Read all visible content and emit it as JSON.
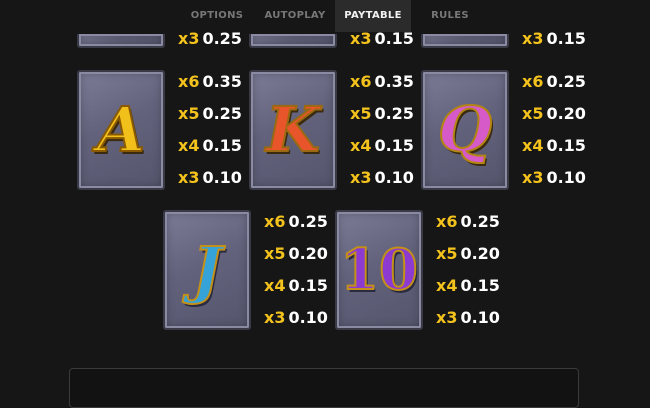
{
  "tabs": [
    {
      "label": "OPTIONS",
      "active": false
    },
    {
      "label": "AUTOPLAY",
      "active": false
    },
    {
      "label": "PAYTABLE",
      "active": true
    },
    {
      "label": "RULES",
      "active": false
    }
  ],
  "top_partial_rows": [
    {
      "mult": "x3",
      "amount": "0.25"
    },
    {
      "mult": "x3",
      "amount": "0.15"
    },
    {
      "mult": "x3",
      "amount": "0.15"
    }
  ],
  "symbols": [
    {
      "glyph": "A",
      "pays": [
        {
          "mult": "x6",
          "amount": "0.35"
        },
        {
          "mult": "x5",
          "amount": "0.25"
        },
        {
          "mult": "x4",
          "amount": "0.15"
        },
        {
          "mult": "x3",
          "amount": "0.10"
        }
      ]
    },
    {
      "glyph": "K",
      "pays": [
        {
          "mult": "x6",
          "amount": "0.35"
        },
        {
          "mult": "x5",
          "amount": "0.25"
        },
        {
          "mult": "x4",
          "amount": "0.15"
        },
        {
          "mult": "x3",
          "amount": "0.10"
        }
      ]
    },
    {
      "glyph": "Q",
      "pays": [
        {
          "mult": "x6",
          "amount": "0.25"
        },
        {
          "mult": "x5",
          "amount": "0.20"
        },
        {
          "mult": "x4",
          "amount": "0.15"
        },
        {
          "mult": "x3",
          "amount": "0.10"
        }
      ]
    },
    {
      "glyph": "J",
      "pays": [
        {
          "mult": "x6",
          "amount": "0.25"
        },
        {
          "mult": "x5",
          "amount": "0.20"
        },
        {
          "mult": "x4",
          "amount": "0.15"
        },
        {
          "mult": "x3",
          "amount": "0.10"
        }
      ]
    },
    {
      "glyph": "10",
      "pays": [
        {
          "mult": "x6",
          "amount": "0.25"
        },
        {
          "mult": "x5",
          "amount": "0.20"
        },
        {
          "mult": "x4",
          "amount": "0.15"
        },
        {
          "mult": "x3",
          "amount": "0.10"
        }
      ]
    }
  ],
  "bottom_panel": {
    "text": ""
  },
  "colors": {
    "background": "#161616",
    "multiplier": "#f4c21d",
    "amount": "#ffffff",
    "active_tab": "#2b2b2b"
  }
}
